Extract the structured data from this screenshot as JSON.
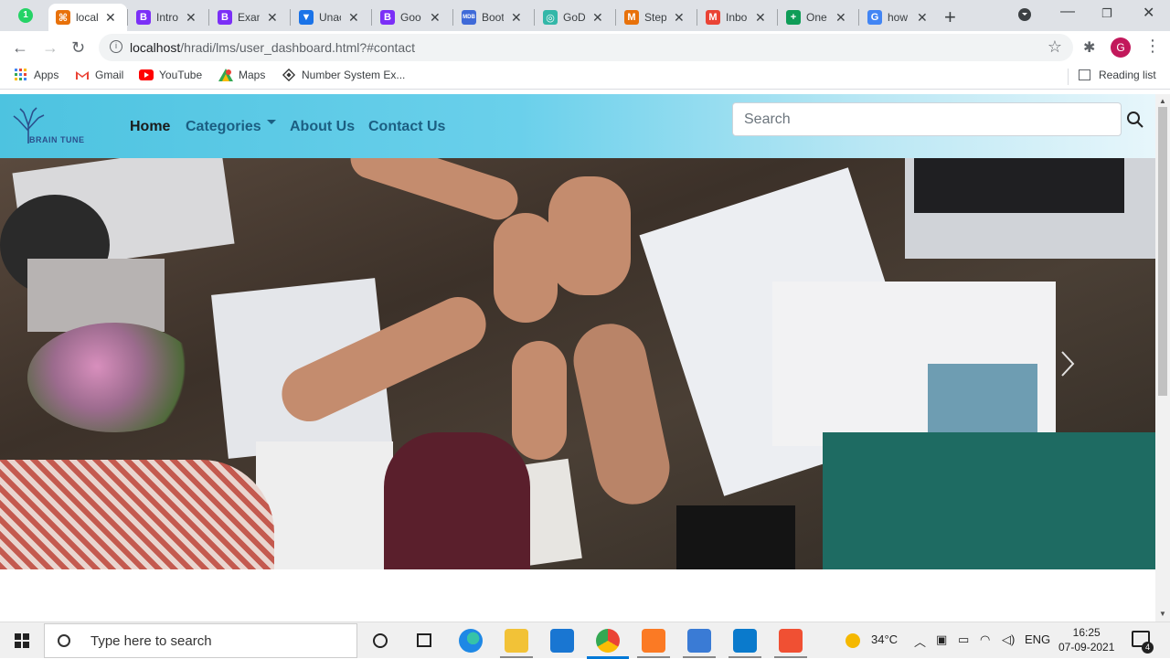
{
  "browser": {
    "tabs": [
      {
        "title": "local",
        "fav_color": "#e8710a",
        "fav_text": "⌘"
      },
      {
        "title": "Intro",
        "fav_color": "#7b2ff7",
        "fav_text": "B"
      },
      {
        "title": "Exan",
        "fav_color": "#7b2ff7",
        "fav_text": "B"
      },
      {
        "title": "Unac",
        "fav_color": "#1a73e8",
        "fav_text": "▼"
      },
      {
        "title": "Goo",
        "fav_color": "#7b2ff7",
        "fav_text": "B"
      },
      {
        "title": "Boot",
        "fav_color": "#3f6ad8",
        "fav_text": "MDB"
      },
      {
        "title": "GoD",
        "fav_color": "#33b7a8",
        "fav_text": "◎"
      },
      {
        "title": "Step",
        "fav_color": "#e8710a",
        "fav_text": "M"
      },
      {
        "title": "Inbo",
        "fav_color": "#ea4335",
        "fav_text": "M"
      },
      {
        "title": "One",
        "fav_color": "#0f9d58",
        "fav_text": "+"
      },
      {
        "title": "how",
        "fav_color": "#4285f4",
        "fav_text": "G"
      }
    ],
    "whatsapp_badge": "1",
    "url_host": "localhost",
    "url_path": "/hradi/lms/user_dashboard.html?#contact",
    "avatar_initial": "G",
    "bookmarks": [
      {
        "label": "Apps"
      },
      {
        "label": "Gmail"
      },
      {
        "label": "YouTube"
      },
      {
        "label": "Maps"
      },
      {
        "label": "Number System Ex..."
      }
    ],
    "reading_list": "Reading list"
  },
  "site": {
    "brand": "BRAIN TUNE",
    "nav": {
      "home": "Home",
      "categories": "Categories",
      "about": "About Us",
      "contact": "Contact Us"
    },
    "search_placeholder": "Search"
  },
  "taskbar": {
    "search_placeholder": "Type here to search",
    "temperature": "34°C",
    "language": "ENG",
    "time": "16:25",
    "date": "07-09-2021",
    "notification_count": "4"
  }
}
